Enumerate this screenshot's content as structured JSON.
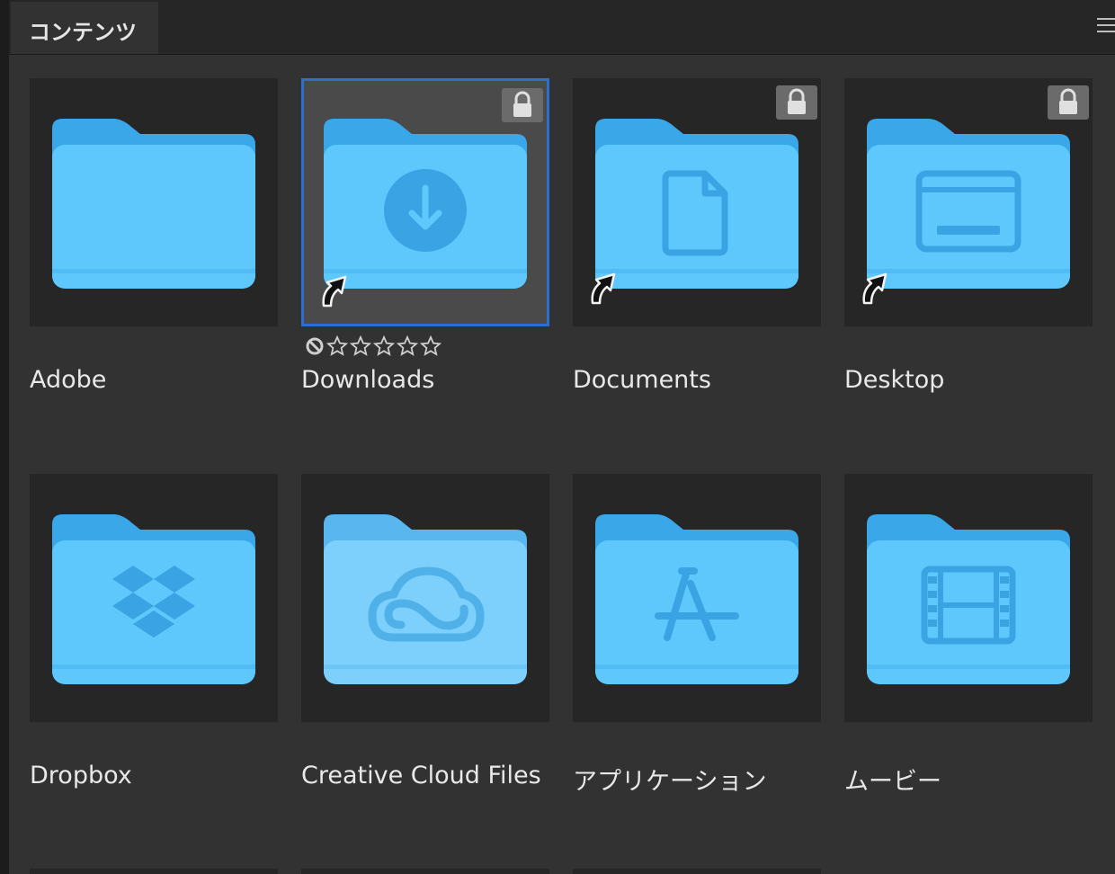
{
  "panel": {
    "tab_label": "コンテンツ",
    "menu_icon": "hamburger-menu-icon"
  },
  "items": [
    {
      "label": "Adobe",
      "emblem": "",
      "locked": false,
      "alias": false,
      "selected": false
    },
    {
      "label": "Downloads",
      "emblem": "download-arrow-icon",
      "locked": true,
      "alias": true,
      "selected": true
    },
    {
      "label": "Documents",
      "emblem": "document-icon",
      "locked": true,
      "alias": true,
      "selected": false
    },
    {
      "label": "Desktop",
      "emblem": "desktop-window-icon",
      "locked": true,
      "alias": true,
      "selected": false
    },
    {
      "label": "Dropbox",
      "emblem": "dropbox-icon",
      "locked": false,
      "alias": false,
      "selected": false
    },
    {
      "label": "Creative Cloud Files",
      "emblem": "creative-cloud-icon",
      "locked": false,
      "alias": false,
      "selected": false
    },
    {
      "label": "アプリケーション",
      "emblem": "app-store-icon",
      "locked": false,
      "alias": false,
      "selected": false
    },
    {
      "label": "ムービー",
      "emblem": "film-strip-icon",
      "locked": false,
      "alias": false,
      "selected": false
    }
  ],
  "rating": {
    "stars": 0,
    "max": 5,
    "reject_icon": "reject-icon"
  },
  "colors": {
    "folder_back": "#3aa7e8",
    "folder_front": "#5ec8fc",
    "emblem": "#39a3e3",
    "selection": "#2a6fd1"
  }
}
